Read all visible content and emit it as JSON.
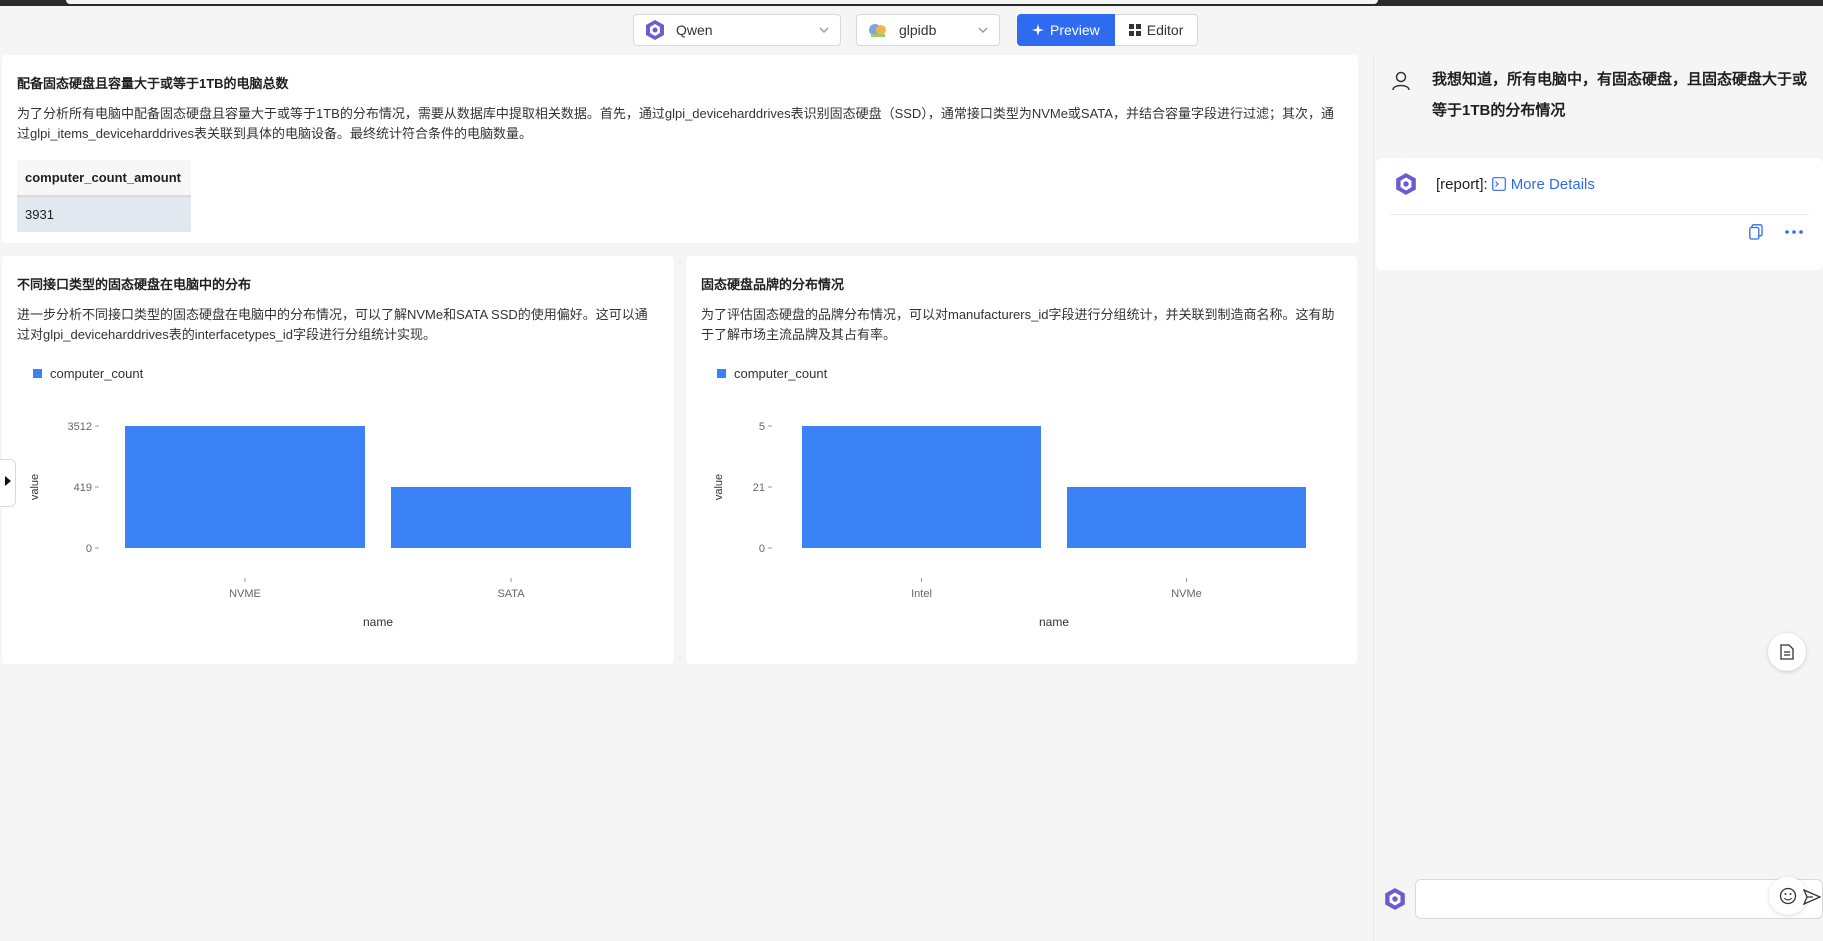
{
  "header": {
    "model": {
      "label": "Qwen",
      "logo": "qwen-logo-icon"
    },
    "database": {
      "label": "glpidb",
      "logo": "database-logo-icon"
    },
    "view_toggle": {
      "preview": "Preview",
      "editor": "Editor"
    },
    "accent": "#2f6bf0"
  },
  "summary_panel": {
    "title": "配备固态硬盘且容量大于或等于1TB的电脑总数",
    "description": "为了分析所有电脑中配备固态硬盘且容量大于或等于1TB的分布情况，需要从数据库中提取相关数据。首先，通过glpi_deviceharddrives表识别固态硬盘（SSD），通常接口类型为NVMe或SATA，并结合容量字段进行过滤；其次，通过glpi_items_deviceharddrives表关联到具体的电脑设备。最终统计符合条件的电脑数量。",
    "table": {
      "header": "computer_count_amount",
      "value": "3931"
    }
  },
  "interface_panel": {
    "title": "不同接口类型的固态硬盘在电脑中的分布",
    "description": "进一步分析不同接口类型的固态硬盘在电脑中的分布情况，可以了解NVMe和SATA SSD的使用偏好。这可以通过对glpi_deviceharddrives表的interfacetypes_id字段进行分组统计实现。"
  },
  "brand_panel": {
    "title": "固态硬盘品牌的分布情况",
    "description": "为了评估固态硬盘的品牌分布情况，可以对manufacturers_id字段进行分组统计，并关联到制造商名称。这有助于了解市场主流品牌及其占有率。"
  },
  "chat": {
    "user_message": "我想知道，所有电脑中，有固态硬盘，且固态硬盘大于或等于1TB的分布情况",
    "bot_prefix": "[report]:",
    "bot_link": "More Details",
    "input_placeholder": ""
  },
  "chart_data": [
    {
      "type": "bar",
      "categories": [
        "NVME",
        "SATA"
      ],
      "series": [
        {
          "name": "computer_count",
          "values": [
            3512,
            419
          ]
        }
      ],
      "y_tick_labels": [
        "0",
        "419",
        "3512"
      ],
      "xlabel": "name",
      "ylabel": "value",
      "legend": "top-left",
      "color": "#3b82f6"
    },
    {
      "type": "bar",
      "categories": [
        "Intel",
        "NVMe"
      ],
      "series": [
        {
          "name": "computer_count",
          "values": [
            5,
            21
          ]
        }
      ],
      "y_tick_labels": [
        "0",
        "21",
        "5"
      ],
      "xlabel": "name",
      "ylabel": "value",
      "legend": "top-left",
      "color": "#3b82f6"
    }
  ]
}
